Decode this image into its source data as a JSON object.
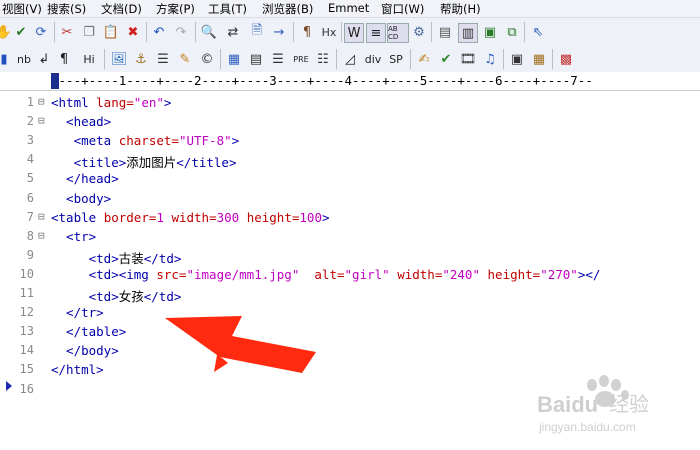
{
  "menubar": {
    "items": [
      "视图(V)",
      "搜索(S)",
      "文档(D)",
      "方案(P)",
      "工具(T)",
      "浏览器(B)",
      "Emmet",
      "窗口(W)",
      "帮助(H)"
    ]
  },
  "toolbar2": {
    "text_buttons": [
      "nb",
      "Hi",
      "PRE",
      "div",
      "SP"
    ]
  },
  "ruler": {
    "text": "----+----1----+----2----+----3----+----4----+----5----+----6----+----7--"
  },
  "editor": {
    "line_numbers": [
      "1",
      "2",
      "3",
      "4",
      "5",
      "6",
      "7",
      "8",
      "9",
      "10",
      "11",
      "12",
      "13",
      "14",
      "15",
      "16"
    ],
    "lines": [
      {
        "parts": [
          {
            "t": "<html ",
            "c": "tag"
          },
          {
            "t": "lang=",
            "c": "attr"
          },
          {
            "t": "\"en\"",
            "c": "val"
          },
          {
            "t": ">",
            "c": "tag"
          }
        ]
      },
      {
        "parts": [
          {
            "t": "  <head>",
            "c": "tag"
          }
        ]
      },
      {
        "parts": [
          {
            "t": "   <meta ",
            "c": "tag"
          },
          {
            "t": "charset=",
            "c": "attr"
          },
          {
            "t": "\"UTF-8\"",
            "c": "val"
          },
          {
            "t": ">",
            "c": "tag"
          }
        ]
      },
      {
        "parts": [
          {
            "t": "   <title>",
            "c": "tag"
          },
          {
            "t": "添加图片",
            "c": "txt"
          },
          {
            "t": "</title>",
            "c": "tag"
          }
        ]
      },
      {
        "parts": [
          {
            "t": "  </head>",
            "c": "tag"
          }
        ]
      },
      {
        "parts": [
          {
            "t": "  <body>",
            "c": "tag"
          }
        ]
      },
      {
        "parts": [
          {
            "t": "<table ",
            "c": "tag"
          },
          {
            "t": "border=",
            "c": "attr"
          },
          {
            "t": "1 ",
            "c": "val"
          },
          {
            "t": "width=",
            "c": "attr"
          },
          {
            "t": "300 ",
            "c": "val"
          },
          {
            "t": "height=",
            "c": "attr"
          },
          {
            "t": "100",
            "c": "val"
          },
          {
            "t": ">",
            "c": "tag"
          }
        ]
      },
      {
        "parts": [
          {
            "t": "  <tr>",
            "c": "tag"
          }
        ]
      },
      {
        "parts": [
          {
            "t": "     <td>",
            "c": "tag"
          },
          {
            "t": "古装",
            "c": "txt"
          },
          {
            "t": "</td>",
            "c": "tag"
          }
        ]
      },
      {
        "parts": [
          {
            "t": "     <td><img ",
            "c": "tag"
          },
          {
            "t": "src=",
            "c": "attr"
          },
          {
            "t": "\"image/mm1.jpg\"  ",
            "c": "val"
          },
          {
            "t": "alt=",
            "c": "attr"
          },
          {
            "t": "\"girl\" ",
            "c": "val"
          },
          {
            "t": "width=",
            "c": "attr"
          },
          {
            "t": "\"240\" ",
            "c": "val"
          },
          {
            "t": "height=",
            "c": "attr"
          },
          {
            "t": "\"270\"",
            "c": "val"
          },
          {
            "t": "></",
            "c": "tag"
          }
        ]
      },
      {
        "parts": [
          {
            "t": "     <td>",
            "c": "tag"
          },
          {
            "t": "女孩",
            "c": "txt"
          },
          {
            "t": "</td>",
            "c": "tag"
          }
        ]
      },
      {
        "parts": [
          {
            "t": "  </tr>",
            "c": "tag"
          }
        ]
      },
      {
        "parts": [
          {
            "t": "  </table>",
            "c": "tag"
          }
        ]
      },
      {
        "parts": [
          {
            "t": "  </body>",
            "c": "tag"
          }
        ]
      },
      {
        "parts": [
          {
            "t": "</html>",
            "c": "tag"
          }
        ]
      },
      {
        "parts": []
      }
    ],
    "fold_lines": [
      1,
      2,
      7,
      8
    ]
  },
  "watermark": {
    "brand": "Baidu",
    "brand_cn": "经验",
    "url": "jingyan.baidu.com"
  },
  "colors": {
    "tag": "#0000aa",
    "attribute": "#c00000",
    "value": "#c000c0",
    "text": "#000000",
    "arrow": "#ff2a10"
  }
}
